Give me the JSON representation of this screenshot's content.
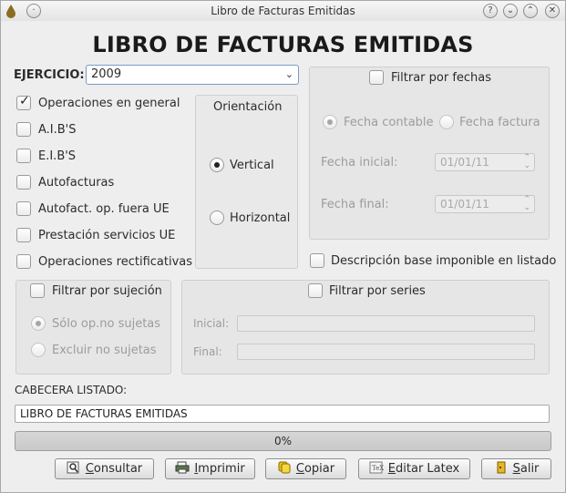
{
  "window": {
    "title": "Libro de Facturas Emitidas"
  },
  "heading": "LIBRO DE FACTURAS EMITIDAS",
  "ejercicio": {
    "label": "EJERCICIO:",
    "value": "2009"
  },
  "operaciones": [
    {
      "label": "Operaciones en general",
      "checked": true
    },
    {
      "label": "A.I.B'S",
      "checked": false
    },
    {
      "label": "E.I.B'S",
      "checked": false
    },
    {
      "label": "Autofacturas",
      "checked": false
    },
    {
      "label": "Autofact. op. fuera UE",
      "checked": false
    },
    {
      "label": "Prestación servicios UE",
      "checked": false
    },
    {
      "label": "Operaciones rectificativas",
      "checked": false
    }
  ],
  "orientacion": {
    "title": "Orientación",
    "vertical": "Vertical",
    "horizontal": "Horizontal",
    "selected": "vertical"
  },
  "fechas": {
    "label": "Filtrar por fechas",
    "contable": "Fecha contable",
    "factura": "Fecha factura",
    "inicial_label": "Fecha inicial:",
    "inicial_value": "01/01/11",
    "final_label": "Fecha final:",
    "final_value": "01/01/11"
  },
  "descripcion_base": "Descripción base imponible en listado",
  "sujecion": {
    "label": "Filtrar por sujeción",
    "solo": "Sólo op.no sujetas",
    "excluir": "Excluir no sujetas"
  },
  "series": {
    "label": "Filtrar por series",
    "inicial": "Inicial:",
    "final": "Final:"
  },
  "cabecera": {
    "label": "CABECERA LISTADO:",
    "value": "LIBRO DE FACTURAS EMITIDAS"
  },
  "progress": {
    "text": "0%",
    "value": 0
  },
  "buttons": {
    "consultar_u": "C",
    "consultar_rest": "onsultar",
    "imprimir_u": "I",
    "imprimir_rest": "mprimir",
    "copiar_u": "C",
    "copiar_rest": "opiar",
    "editar_u": "E",
    "editar_rest": "ditar Latex",
    "salir_u": "S",
    "salir_rest": "alir"
  }
}
